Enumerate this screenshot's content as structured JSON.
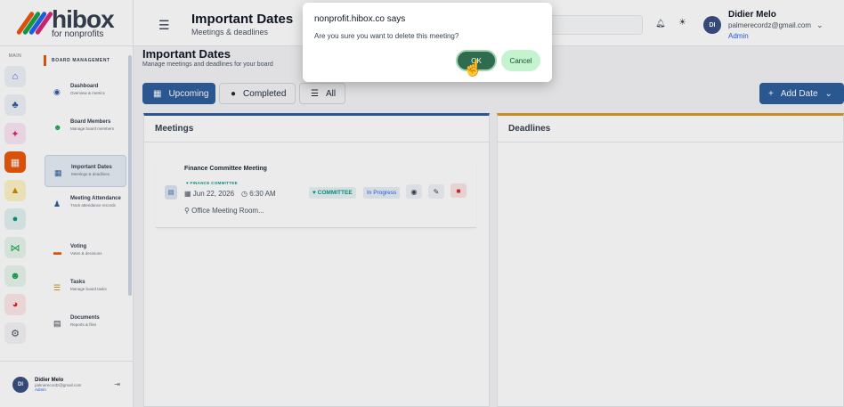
{
  "logo": {
    "brand": "hibox",
    "tagline": "for nonprofits"
  },
  "rail": {
    "label": "MAIN",
    "icons": [
      {
        "name": "home-icon",
        "glyph": "⌂",
        "color": "#2563eb",
        "bg": "#eef2f7"
      },
      {
        "name": "org-chart-icon",
        "glyph": "♣",
        "color": "#2f5f9e",
        "bg": "#eef2f7"
      },
      {
        "name": "handshake-icon",
        "glyph": "✦",
        "color": "#db2777",
        "bg": "#fce7f3"
      },
      {
        "name": "calendar-icon",
        "glyph": "▦",
        "color": "#fff",
        "bg": "#ea580c"
      },
      {
        "name": "graduation-icon",
        "glyph": "▲",
        "color": "#ca8a04",
        "bg": "#fef3c7"
      },
      {
        "name": "globe-icon",
        "glyph": "●",
        "color": "#0d9488",
        "bg": "#e0f2f1"
      },
      {
        "name": "network-icon",
        "glyph": "⋈",
        "color": "#16a34a",
        "bg": "#e7f6ec"
      },
      {
        "name": "users-icon",
        "glyph": "☻",
        "color": "#16a34a",
        "bg": "#e7f6ec"
      },
      {
        "name": "pie-chart-icon",
        "glyph": "◕",
        "color": "#dc2626",
        "bg": "#fde8e8"
      },
      {
        "name": "settings-icon",
        "glyph": "⚙",
        "color": "#4b5563",
        "bg": "#f3f4f6"
      }
    ]
  },
  "sidebar": {
    "section": "BOARD MANAGEMENT",
    "items": [
      {
        "title": "Dashboard",
        "sub": "Overview & metrics",
        "glyph": "◉",
        "color": "#2f5f9e"
      },
      {
        "title": "Board Members",
        "sub": "Manage board members",
        "glyph": "☻",
        "color": "#16a34a"
      },
      {
        "title": "Important Dates",
        "sub": "Meetings & deadlines",
        "glyph": "▦",
        "color": "#2f5f9e"
      },
      {
        "title": "Meeting Attendance",
        "sub": "Track attendance records",
        "glyph": "♟",
        "color": "#2f5f9e"
      },
      {
        "title": "Voting",
        "sub": "Votes & decisions",
        "glyph": "▬",
        "color": "#ea580c"
      },
      {
        "title": "Tasks",
        "sub": "Manage board tasks",
        "glyph": "☰",
        "color": "#ca8a04"
      },
      {
        "title": "Documents",
        "sub": "Reports & files",
        "glyph": "▤",
        "color": "#374151"
      }
    ],
    "footer": {
      "initials": "DI",
      "name": "Didier Melo",
      "email": "palmerecordz@gmail.com",
      "role": "Admin"
    }
  },
  "header": {
    "title": "Important Dates",
    "subtitle": "Meetings & deadlines",
    "user": {
      "initials": "DI",
      "name": "Didier Melo",
      "email": "palmerecordz@gmail.com",
      "role": "Admin"
    }
  },
  "main": {
    "title": "Important Dates",
    "subtitle": "Manage meetings and deadlines for your board",
    "filters": {
      "upcoming": "Upcoming",
      "completed": "Completed",
      "all": "All"
    },
    "add_date": "Add Date",
    "meetings_heading": "Meetings",
    "deadlines_heading": "Deadlines",
    "meeting": {
      "title": "Finance Committee Meeting",
      "tag": "FINANCE COMMITTEE",
      "date": "Jun 22, 2026",
      "time": "6:30 AM",
      "location": "Office Meeting Room...",
      "type_badge": "COMMITTEE",
      "status_badge": "In Progress"
    }
  },
  "dialog": {
    "title": "nonprofit.hibox.co says",
    "message": "Are you sure you want to delete this meeting?",
    "ok": "OK",
    "cancel": "Cancel"
  }
}
